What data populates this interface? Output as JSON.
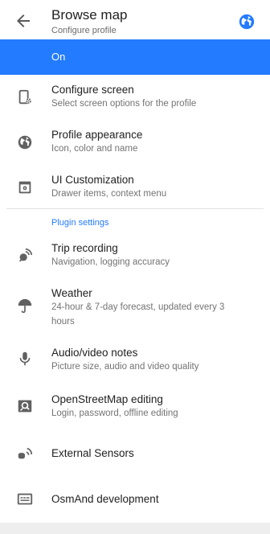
{
  "header": {
    "title": "Browse map",
    "subtitle": "Configure profile"
  },
  "toggle": {
    "label": "On",
    "color": "#237bff"
  },
  "items_top": [
    {
      "title": "Configure screen",
      "desc": "Select screen options for the profile",
      "icon": "configure-screen-icon"
    },
    {
      "title": "Profile appearance",
      "desc": "Icon, color and name",
      "icon": "globe-icon"
    },
    {
      "title": "UI Customization",
      "desc": "Drawer items, context menu",
      "icon": "ui-customization-icon"
    }
  ],
  "section_title": "Plugin settings",
  "items_plugins": [
    {
      "title": "Trip recording",
      "desc": "Navigation, logging accuracy",
      "icon": "satellite-icon"
    },
    {
      "title": "Weather",
      "desc": "24-hour & 7-day forecast, updated every 3 hours",
      "icon": "umbrella-icon"
    },
    {
      "title": "Audio/video notes",
      "desc": "Picture size, audio and video quality",
      "icon": "microphone-icon"
    },
    {
      "title": "OpenStreetMap editing",
      "desc": "Login, password, offline editing",
      "icon": "osm-edit-icon"
    },
    {
      "title": "External Sensors",
      "desc": "",
      "icon": "sensor-icon"
    },
    {
      "title": "OsmAnd development",
      "desc": "",
      "icon": "development-icon"
    }
  ]
}
